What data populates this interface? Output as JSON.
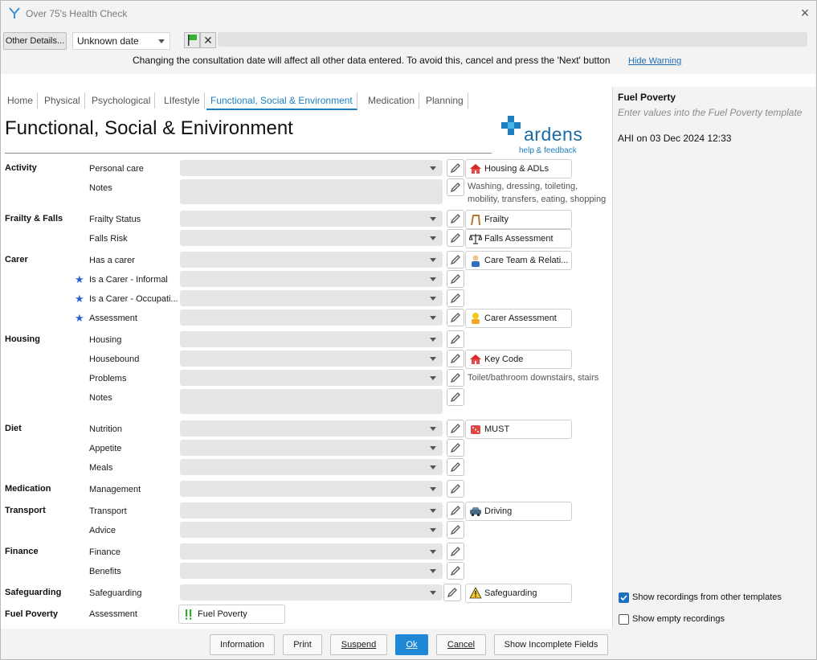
{
  "window": {
    "title": "Over 75's Health Check"
  },
  "toolbar": {
    "other_details": "Other Details...",
    "date_value": "Unknown date",
    "warning": "Changing the consultation date will affect all other data entered. To avoid this, cancel and press the 'Next' button",
    "hide_warning": "Hide Warning"
  },
  "tabs": [
    "Home",
    "Physical",
    "Psychological",
    "LIfestyle",
    "Functional, Social & Environment",
    "Medication",
    "Planning"
  ],
  "page": {
    "title": "Functional, Social & Enivironment",
    "logo_text": "ardens",
    "logo_sub": "help & feedback"
  },
  "sections": {
    "activity": "Activity",
    "frailty": "Frailty & Falls",
    "carer": "Carer",
    "housing": "Housing",
    "diet": "Diet",
    "medication": "Medication",
    "transport": "Transport",
    "finance": "Finance",
    "safeguarding": "Safeguarding",
    "fuel": "Fuel Poverty"
  },
  "fields": {
    "personal_care": "Personal care",
    "activity_notes": "Notes",
    "frailty_status": "Frailty Status",
    "falls_risk": "Falls Risk",
    "has_carer": "Has a carer",
    "carer_informal": "Is a Carer - Informal",
    "carer_occupational": "Is a Carer - Occupati...",
    "carer_assessment": "Assessment",
    "housing": "Housing",
    "housebound": "Housebound",
    "problems": "Problems",
    "housing_notes": "Notes",
    "nutrition": "Nutrition",
    "appetite": "Appetite",
    "meals": "Meals",
    "management": "Management",
    "transport": "Transport",
    "advice": "Advice",
    "finance": "Finance",
    "benefits": "Benefits",
    "safeguarding": "Safeguarding",
    "fuel_assessment": "Assessment"
  },
  "links": {
    "housing_adls": "Housing & ADLs",
    "frailty": "Frailty",
    "falls_assessment": "Falls Assessment",
    "care_team": "Care Team & Relati...",
    "carer_assessment": "Carer Assessment",
    "key_code": "Key Code",
    "must": "MUST",
    "driving": "Driving",
    "safeguarding": "Safeguarding",
    "fuel_poverty": "Fuel Poverty"
  },
  "hints": {
    "activity_line1": "Washing, dressing, toileting,",
    "activity_line2": "mobility, transfers, eating, shopping",
    "problems": "Toilet/bathroom downstairs, stairs"
  },
  "side": {
    "title": "Fuel Poverty",
    "subtitle": "Enter values into the Fuel Poverty template",
    "entry": "AHI on 03 Dec 2024 12:33",
    "show_other": "Show recordings from other templates",
    "show_empty": "Show empty recordings"
  },
  "buttons": {
    "information": "Information",
    "print": "Print",
    "suspend": "Suspend",
    "ok": "Ok",
    "cancel": "Cancel",
    "show_incomplete": "Show Incomplete Fields"
  },
  "colors": {
    "accent": "#1d7fc0",
    "ok_button": "#1e88d6",
    "star": "#2a62d4"
  }
}
